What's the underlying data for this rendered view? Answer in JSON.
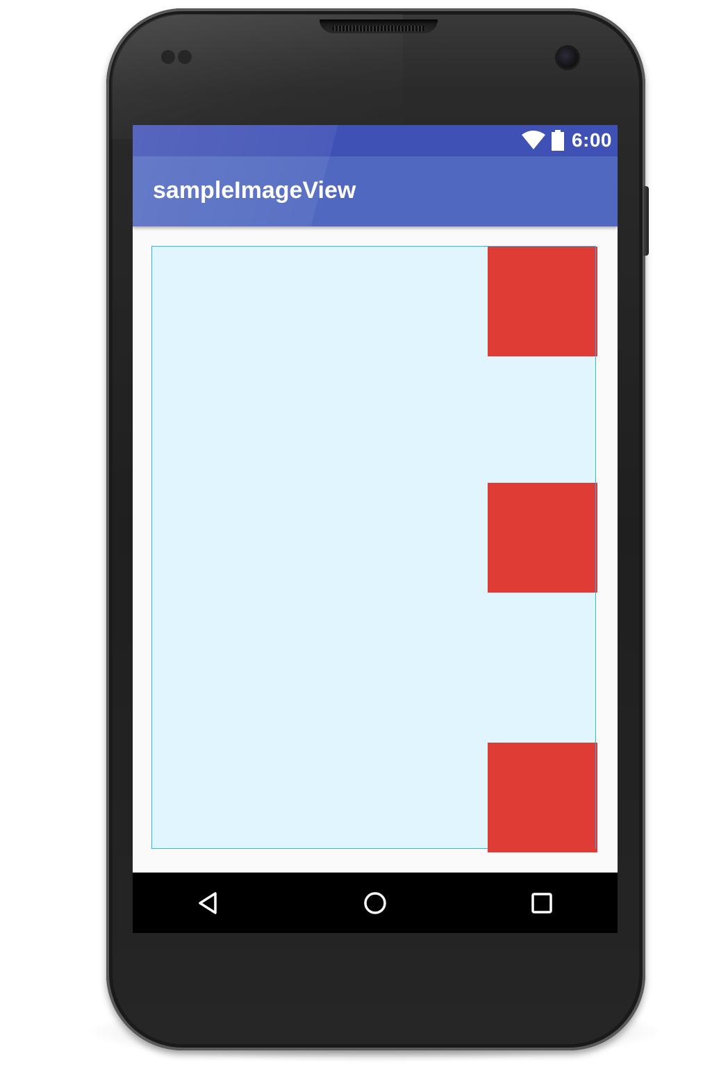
{
  "status_bar": {
    "time": "6:00",
    "wifi_icon": "wifi-icon",
    "battery_icon": "battery-icon"
  },
  "app_bar": {
    "title": "sampleImageView"
  },
  "content": {
    "image_view_background": "#e1f5fe",
    "image_view_border": "#29b6f6",
    "block_color": "#de3c34",
    "blocks": [
      "red-block",
      "red-block",
      "red-block"
    ]
  },
  "nav_bar": {
    "back_icon": "back-triangle-icon",
    "home_icon": "home-circle-icon",
    "recents_icon": "recents-square-icon"
  },
  "colors": {
    "primary_dark": "#3f51b5",
    "primary": "#5068c0"
  }
}
